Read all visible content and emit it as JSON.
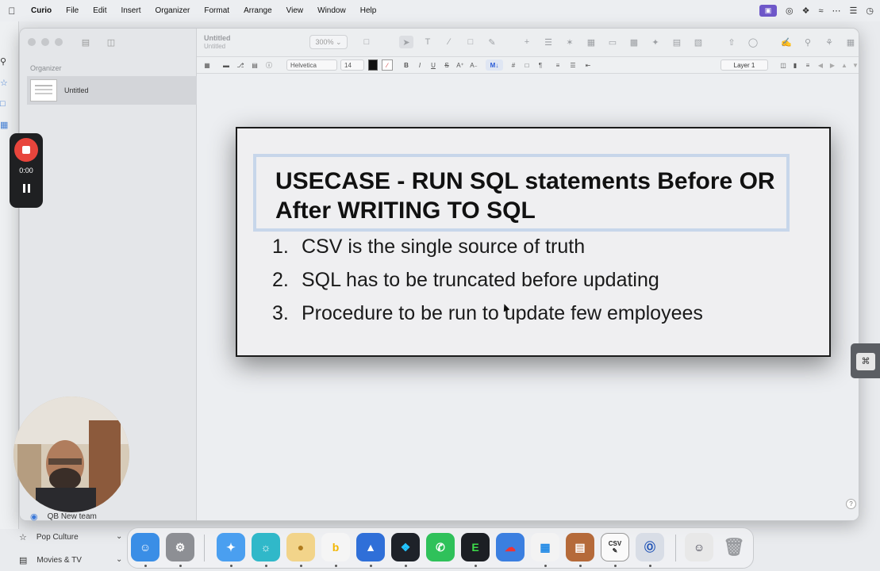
{
  "menubar": {
    "app_name": "Curio",
    "items": [
      "File",
      "Edit",
      "Insert",
      "Organizer",
      "Format",
      "Arrange",
      "View",
      "Window",
      "Help"
    ]
  },
  "sidebar": {
    "organizer_label": "Organizer",
    "item_label": "Untitled"
  },
  "toolbar": {
    "doc_title": "Untitled",
    "doc_subtitle": "Untitled",
    "zoom": "300%"
  },
  "formatbar": {
    "font": "Helvetica",
    "size": "14",
    "bold": "B",
    "italic": "I",
    "underline": "U",
    "strike": "S",
    "markdown": "M↓",
    "hash": "#",
    "pilcrow": "¶",
    "layer": "Layer 1"
  },
  "slide": {
    "title": "USECASE - RUN SQL statements Before OR After WRITING TO SQL",
    "bullets": [
      {
        "num": "1.",
        "text": "CSV is the single source of truth"
      },
      {
        "num": "2.",
        "text": "SQL has to be truncated before updating"
      },
      {
        "num": "3.",
        "text": "Procedure to be run to update few employees"
      }
    ]
  },
  "recorder": {
    "time": "0:00"
  },
  "background_sidebar": {
    "team": "QB New team",
    "pop_culture": "Pop Culture",
    "movies_tv": "Movies & TV"
  },
  "dock": {
    "csv_label": "CSV"
  },
  "colors": {
    "record_red": "#e8453c",
    "selection_blue": "#c7d6ea",
    "accent_purple": "#6e57c9"
  }
}
